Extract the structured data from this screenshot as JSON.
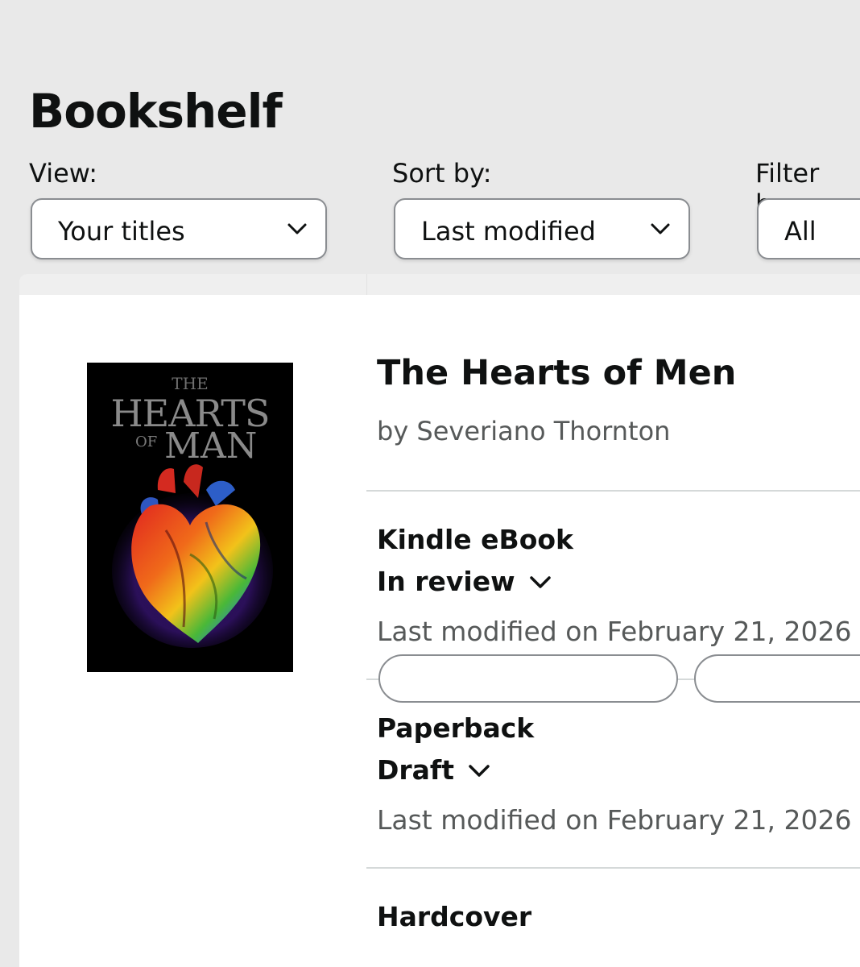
{
  "header": {
    "title": "Bookshelf"
  },
  "controls": {
    "view": {
      "label": "View:",
      "value": "Your titles"
    },
    "sort": {
      "label": "Sort by:",
      "value": "Last modified"
    },
    "filter": {
      "label": "Filter by:",
      "value": "All"
    }
  },
  "book": {
    "title": "The Hearts of Men",
    "author": "by Severiano Thornton",
    "cover": {
      "line1": "THE",
      "line2": "HEARTS",
      "line3a": "OF",
      "line3b": "MAN"
    },
    "formats": [
      {
        "name": "Kindle eBook",
        "status": "In review",
        "modified": "Last modified on February 21, 2026"
      },
      {
        "name": "Paperback",
        "status": "Draft",
        "modified": "Last modified on February 21, 2026"
      },
      {
        "name": "Hardcover"
      }
    ]
  },
  "colors": {
    "background": "#e9e9e9",
    "card": "#ffffff",
    "text": "#0f1111",
    "muted_text": "#565959",
    "border": "#8a8d91"
  }
}
